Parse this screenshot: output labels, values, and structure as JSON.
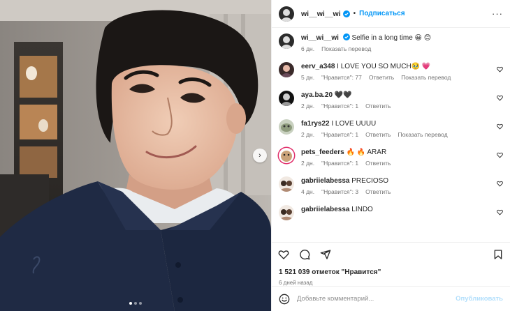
{
  "post": {
    "author": "wi__wi__wi",
    "follow_label": "Подписаться",
    "separator": "•",
    "more_label": "···",
    "caption": "Selfie in a long time 😀 😊",
    "caption_age": "6 дн.",
    "caption_translate": "Показать перевод"
  },
  "comments": [
    {
      "user": "eerv_a348",
      "text": "I LOVE YOU SO MUCH🥹 💗",
      "age": "5 дн.",
      "likes": "\"Нравится\": 77",
      "reply": "Ответить",
      "translate": "Показать перевод"
    },
    {
      "user": "aya.ba.20",
      "text": "🖤🖤",
      "age": "2 дн.",
      "likes": "\"Нравится\": 1",
      "reply": "Ответить",
      "translate": ""
    },
    {
      "user": "fa1rys22",
      "text": "I LOVE UUUU",
      "age": "2 дн.",
      "likes": "\"Нравится\": 1",
      "reply": "Ответить",
      "translate": "Показать перевод"
    },
    {
      "user": "pets_feeders",
      "text": "🔥 🔥 ARAR",
      "age": "2 дн.",
      "likes": "\"Нравится\": 1",
      "reply": "Ответить",
      "translate": ""
    },
    {
      "user": "gabriielabessa",
      "text": "PRECIOSO",
      "age": "4 дн.",
      "likes": "\"Нравится\": 3",
      "reply": "Ответить",
      "translate": ""
    },
    {
      "user": "gabriielabessa",
      "text": "LINDO",
      "age": "",
      "likes": "",
      "reply": "",
      "translate": ""
    }
  ],
  "stats": {
    "likes": "1 521 039 отметок \"Нравится\"",
    "time": "6 дней назад"
  },
  "composer": {
    "placeholder": "Добавьте комментарий...",
    "publish": "Опубликовать"
  },
  "carousel": {
    "slides": 3,
    "active": 0,
    "next_label": "›"
  },
  "colors": {
    "accent": "#0095f6",
    "publish_disabled": "#b2dffc",
    "muted": "#737373"
  }
}
